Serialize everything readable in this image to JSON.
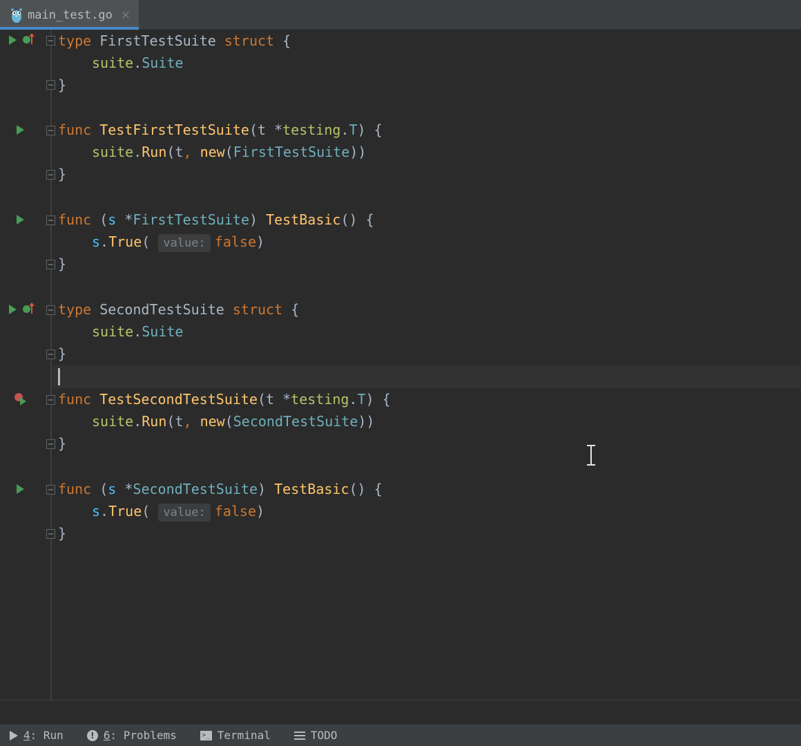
{
  "tab": {
    "filename": "main_test.go",
    "close": "×"
  },
  "code": {
    "l1": {
      "kw_type": "type",
      "name": "FirstTestSuite",
      "kw_struct": "struct",
      "brace": "{"
    },
    "l2": {
      "pkg": "suite",
      "dot": ".",
      "member": "Suite"
    },
    "l3": {
      "close": "}"
    },
    "l5": {
      "kw": "func",
      "name": "TestFirstTestSuite",
      "paren": "(t ",
      "star": "*",
      "pkg": "testing",
      "dot": ".",
      "t": "T",
      "end": ") {"
    },
    "l6": {
      "pkg": "suite",
      "dot": ".",
      "run": "Run",
      "open": "(t",
      "comma": ",",
      "kwnew": "new",
      "p": "(",
      "arg": "FirstTestSuite",
      "end": "))"
    },
    "l7": {
      "close": "}"
    },
    "l9": {
      "kw": "func",
      "open": " (",
      "recv": "s",
      "star": " *",
      "type": "FirstTestSuite",
      "close": ") ",
      "name": "TestBasic",
      "end": "() {"
    },
    "l10": {
      "recv": "s",
      "dot": ".",
      "method": "True",
      "open": "(",
      "hint": "value:",
      "val": "false",
      "end": ")"
    },
    "l11": {
      "close": "}"
    },
    "l13": {
      "kw_type": "type",
      "name": "SecondTestSuite",
      "kw_struct": "struct",
      "brace": "{"
    },
    "l14": {
      "pkg": "suite",
      "dot": ".",
      "member": "Suite"
    },
    "l15": {
      "close": "}"
    },
    "l17": {
      "kw": "func",
      "name": "TestSecondTestSuite",
      "paren": "(t ",
      "star": "*",
      "pkg": "testing",
      "dot": ".",
      "t": "T",
      "end": ") {"
    },
    "l18": {
      "pkg": "suite",
      "dot": ".",
      "run": "Run",
      "open": "(t",
      "comma": ",",
      "kwnew": "new",
      "p": "(",
      "arg": "SecondTestSuite",
      "end": "))"
    },
    "l19": {
      "close": "}"
    },
    "l21": {
      "kw": "func",
      "open": " (",
      "recv": "s",
      "star": " *",
      "type": "SecondTestSuite",
      "close": ") ",
      "name": "TestBasic",
      "end": "() {"
    },
    "l22": {
      "recv": "s",
      "dot": ".",
      "method": "True",
      "open": "(",
      "hint": "value:",
      "val": "false",
      "end": ")"
    },
    "l23": {
      "close": "}"
    }
  },
  "toolwindows": [
    {
      "num": "4",
      "label": ": Run",
      "icon": "run-icon"
    },
    {
      "num": "6",
      "label": ": Problems",
      "icon": "problems-icon"
    },
    {
      "label": "Terminal",
      "icon": "terminal-icon"
    },
    {
      "label": "TODO",
      "icon": "todo-icon"
    }
  ],
  "colors": {
    "keyword": "#cc7832",
    "function": "#ffc66d",
    "package": "#b5c46a",
    "exported": "#6fafbd",
    "run_green": "#499c54",
    "fail_red": "#c75450",
    "tab_accent": "#4a88c7"
  }
}
